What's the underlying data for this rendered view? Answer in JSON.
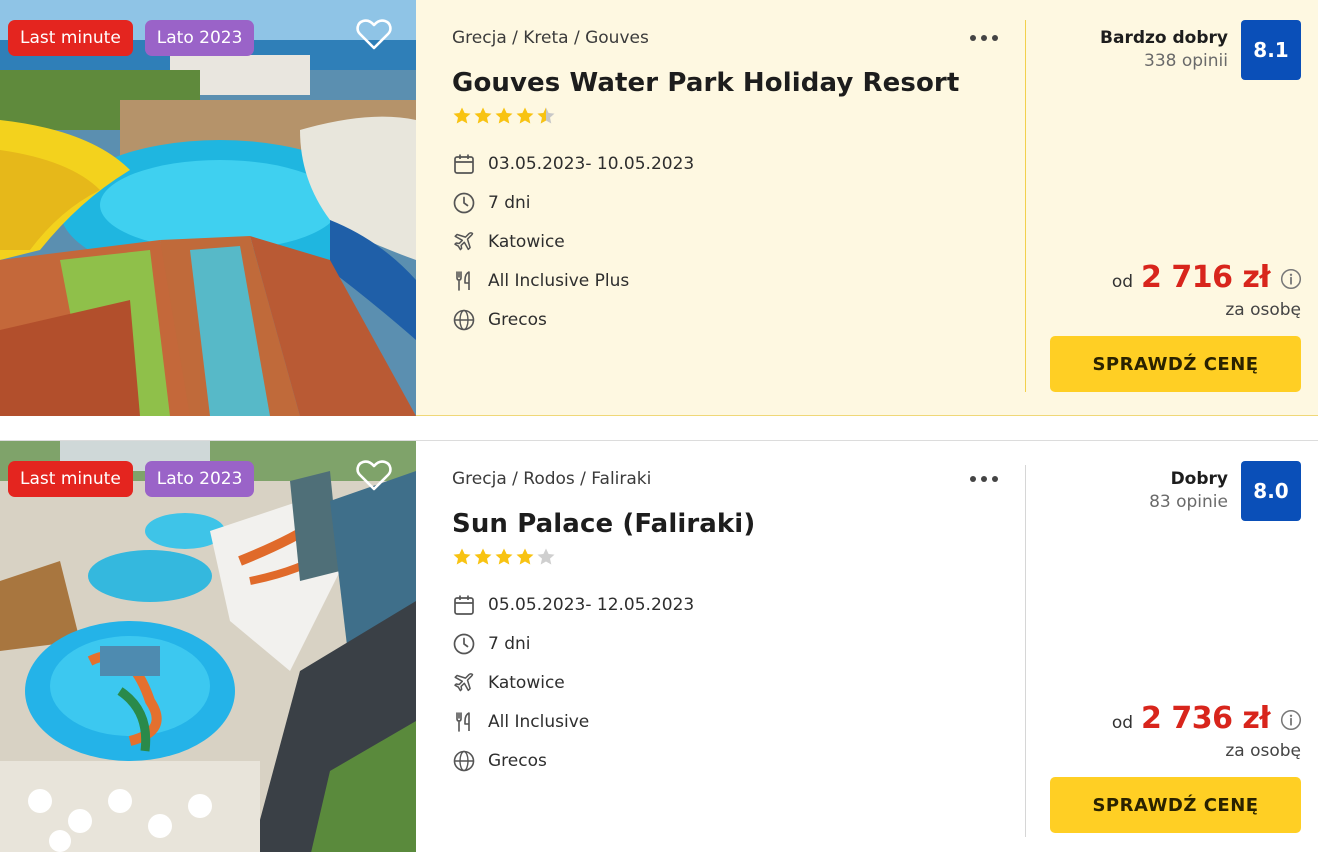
{
  "offers": [
    {
      "badges": [
        "Last minute",
        "Lato 2023"
      ],
      "breadcrumb": "Grecja / Kreta / Gouves",
      "title": "Gouves Water Park Holiday Resort",
      "stars": 4.5,
      "dates": "03.05.2023- 10.05.2023",
      "duration": "7 dni",
      "departure": "Katowice",
      "board": "All Inclusive Plus",
      "operator": "Grecos",
      "rating_label": "Bardzo dobry",
      "reviews": "338 opinii",
      "score": "8.1",
      "price_prefix": "od",
      "price": "2 716 zł",
      "per_person": "za osobę",
      "cta": "SPRAWDŹ CENĘ"
    },
    {
      "badges": [
        "Last minute",
        "Lato 2023"
      ],
      "breadcrumb": "Grecja / Rodos / Faliraki",
      "title": "Sun Palace (Faliraki)",
      "stars": 4,
      "dates": "05.05.2023- 12.05.2023",
      "duration": "7 dni",
      "departure": "Katowice",
      "board": "All Inclusive",
      "operator": "Grecos",
      "rating_label": "Dobry",
      "reviews": "83 opinie",
      "score": "8.0",
      "price_prefix": "od",
      "price": "2 736 zł",
      "per_person": "za osobę",
      "cta": "SPRAWDŹ CENĘ"
    }
  ],
  "colors": {
    "highlight_bg": "#fef8e1",
    "badge_last_minute": "#e4251f",
    "badge_season": "#9a63c8",
    "score_bg": "#0a4fb8",
    "price": "#d8251c",
    "cta_bg": "#ffcf24",
    "star": "#f8c312"
  }
}
